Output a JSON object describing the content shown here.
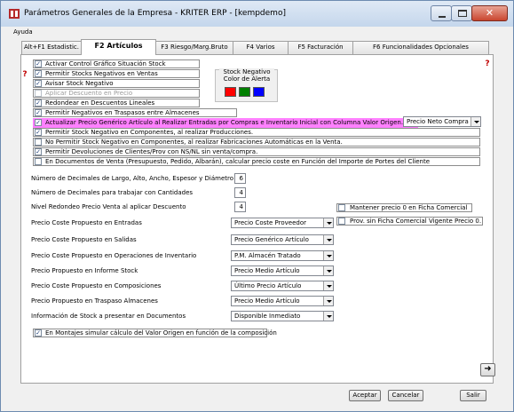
{
  "window": {
    "title": "Parámetros Generales de la Empresa - KRITER ERP - [kempdemo]"
  },
  "menu": {
    "ayuda": "Ayuda"
  },
  "tabs": [
    {
      "label": "Alt+F1 Estadistic."
    },
    {
      "label": "F2 Artículos"
    },
    {
      "label": "F3 Riesgo/Marg.Bruto"
    },
    {
      "label": "F4 Varios"
    },
    {
      "label": "F5 Facturación"
    },
    {
      "label": "F6 Funcionalidades Opcionales"
    }
  ],
  "options": [
    {
      "label": "Activar Control Gráfico Situación Stock",
      "checked": true,
      "disabled": false
    },
    {
      "label": "Permitir Stocks Negativos en Ventas",
      "checked": true,
      "disabled": false
    },
    {
      "label": "Avisar Stock Negativo",
      "checked": true,
      "disabled": false
    },
    {
      "label": "Aplicar Descuento en Precio",
      "checked": false,
      "disabled": true
    },
    {
      "label": "Redondear en Descuentos Lineales",
      "checked": true,
      "disabled": false
    },
    {
      "label": "Permitir Negativos en Traspasos entre Almacenes",
      "checked": true,
      "disabled": false
    },
    {
      "label": "Actualizar Precio Genérico Artículo al Realizar Entradas por Compras e Inventario Inicial con Columna Valor Origen.",
      "checked": true,
      "disabled": false
    },
    {
      "label": "Permitir Stock Negativo en Componentes, al realizar Producciones.",
      "checked": true,
      "disabled": false
    },
    {
      "label": "No Permitir Stock Negativo en Componentes, al realizar Fabricaciones Automáticas en la Venta.",
      "checked": false,
      "disabled": false
    },
    {
      "label": "Permitir Devoluciones de Clientes/Prov con NS/NL sin venta/compra.",
      "checked": true,
      "disabled": false
    },
    {
      "label": "En Documentos de Venta (Presupuesto, Pedido, Albarán), calcular precio coste en Función del Importe de Portes del Cliente",
      "checked": false,
      "disabled": false
    }
  ],
  "stock_negativo": {
    "title": "Stock Negativo Color de Alerta",
    "colors": [
      "#ff0000",
      "#008000",
      "#0000ff"
    ]
  },
  "precio_neto_compra": "Precio Neto Compra",
  "decimales": [
    {
      "label": "Número de Decimales de Largo, Alto, Ancho, Espesor y Diámetro",
      "value": "6"
    },
    {
      "label": "Número de Decimales para trabajar con Cantidades",
      "value": "4"
    },
    {
      "label": "Nivel Redondeo Precio Venta al aplicar Descuento",
      "value": "4"
    }
  ],
  "mantener_precio": {
    "label": "Mantener precio 0 en Ficha Comercial",
    "checked": false
  },
  "prov_sin_ficha": {
    "label": "Prov. sin Ficha Comercial Vigente Precio 0.",
    "checked": false
  },
  "selects": [
    {
      "label": "Precio Coste Propuesto en Entradas",
      "value": "Precio Coste Proveedor"
    },
    {
      "label": "Precio Coste Propuesto en Salidas",
      "value": "Precio Genérico Artículo"
    },
    {
      "label": "Precio Coste Propuesto en Operaciones de Inventario",
      "value": "P.M. Almacén Tratado"
    },
    {
      "label": "Precio Propuesto en Informe Stock",
      "value": "Precio Medio Artículo"
    },
    {
      "label": "Precio Coste Propuesto en Composiciones",
      "value": "Último Precio Artículo"
    },
    {
      "label": "Precio Propuesto en Traspaso Almacenes",
      "value": "Precio Medio Artículo"
    },
    {
      "label": "Información de Stock a presentar en Documentos",
      "value": "Disponible Inmediato"
    }
  ],
  "montajes": {
    "label": "En Montajes simular cálculo del Valor Origen en función de la composición",
    "checked": true
  },
  "buttons": {
    "aceptar": "Aceptar",
    "cancelar": "Cancelar",
    "salir": "Salir"
  },
  "check_mark": "✓"
}
